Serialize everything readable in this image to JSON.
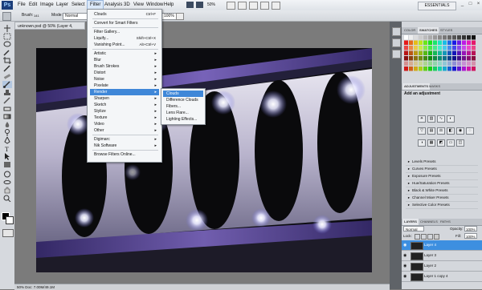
{
  "app": {
    "logo": "Ps",
    "workspace": "ESSENTIALS",
    "zoom": "50%"
  },
  "menubar": [
    "File",
    "Edit",
    "Image",
    "Layer",
    "Select",
    "Filter",
    "Analysis",
    "3D",
    "View",
    "Window",
    "Help"
  ],
  "options": {
    "brush_label": "Brush:",
    "brush_size": "141",
    "mode_label": "Mode:",
    "mode_value": "Normal",
    "opacity_value": "100%"
  },
  "document": {
    "tab": "unknown.psd @ 50% (Layer 4, RGB/8)",
    "status": "50%   Doc: 7.00M/49.1M"
  },
  "filter_menu": {
    "items": [
      {
        "label": "Clouds",
        "shortcut": "Ctrl+F"
      },
      {
        "sep": true
      },
      {
        "label": "Convert for Smart Filters"
      },
      {
        "sep": true
      },
      {
        "label": "Filter Gallery..."
      },
      {
        "label": "Liquify...",
        "shortcut": "Shift+Ctrl+X"
      },
      {
        "label": "Vanishing Point...",
        "shortcut": "Alt+Ctrl+V"
      },
      {
        "sep": true
      },
      {
        "label": "Artistic",
        "sub": true
      },
      {
        "label": "Blur",
        "sub": true
      },
      {
        "label": "Brush Strokes",
        "sub": true
      },
      {
        "label": "Distort",
        "sub": true
      },
      {
        "label": "Noise",
        "sub": true
      },
      {
        "label": "Pixelate",
        "sub": true
      },
      {
        "label": "Render",
        "sub": true,
        "active": true
      },
      {
        "label": "Sharpen",
        "sub": true
      },
      {
        "label": "Sketch",
        "sub": true
      },
      {
        "label": "Stylize",
        "sub": true
      },
      {
        "label": "Texture",
        "sub": true
      },
      {
        "label": "Video",
        "sub": true
      },
      {
        "label": "Other",
        "sub": true
      },
      {
        "sep": true
      },
      {
        "label": "Digimarc",
        "sub": true
      },
      {
        "label": "Nik Software",
        "sub": true
      },
      {
        "sep": true
      },
      {
        "label": "Browse Filters Online..."
      }
    ]
  },
  "render_menu": [
    "Clouds",
    "Difference Clouds",
    "Fibers...",
    "Lens Flare...",
    "Lighting Effects..."
  ],
  "panels": {
    "color_tabs": [
      "COLOR",
      "SWATCHES",
      "STYLES"
    ],
    "adjust_tabs": [
      "ADJUSTMENTS",
      "MASKS"
    ],
    "adjust_title": "Add an adjustment",
    "presets": [
      "Levels Presets",
      "Curves Presets",
      "Exposure Presets",
      "Hue/Saturation Presets",
      "Black & White Presets",
      "Channel Mixer Presets",
      "Selective Color Presets"
    ],
    "layer_tabs": [
      "LAYERS",
      "CHANNELS",
      "PATHS"
    ],
    "blend_mode": "Normal",
    "opacity_label": "Opacity:",
    "opacity": "100%",
    "lock_label": "Lock:",
    "fill_label": "Fill:",
    "fill": "100%",
    "layers": [
      "Layer 4",
      "Layer 3",
      "Layer 2",
      "Layer 1 copy 4"
    ]
  },
  "colors": {
    "accent": "#3f87d8",
    "purple": "#7a5fc2"
  }
}
